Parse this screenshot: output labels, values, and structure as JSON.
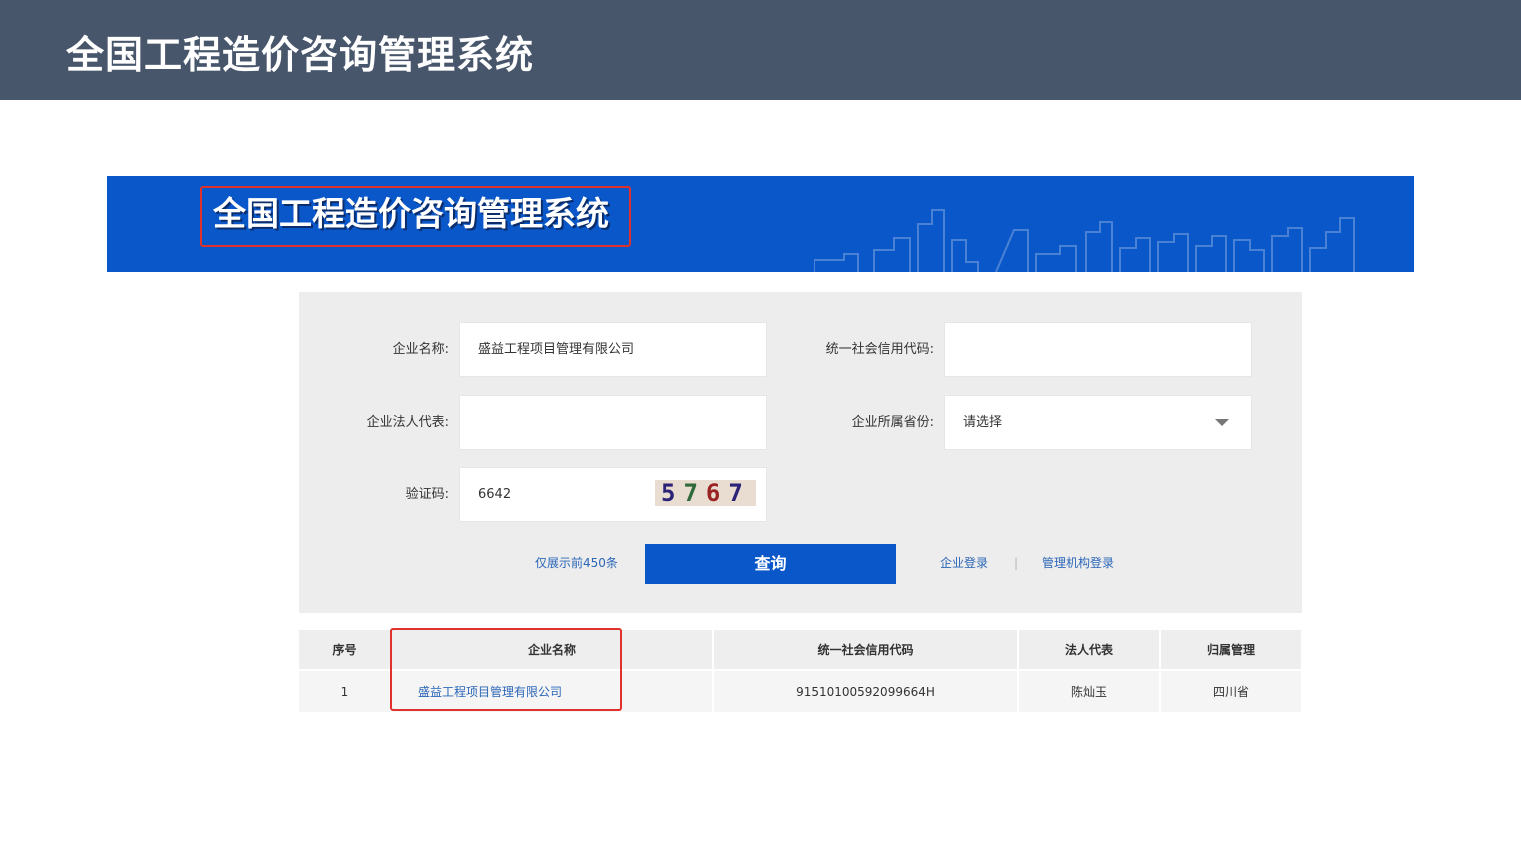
{
  "slide": {
    "title": "全国工程造价咨询管理系统"
  },
  "banner": {
    "title": "全国工程造价咨询管理系统"
  },
  "search_form": {
    "company_name_label": "企业名称:",
    "company_name_value": "盛益工程项目管理有限公司",
    "credit_code_label": "统一社会信用代码:",
    "credit_code_value": "",
    "legal_rep_label": "企业法人代表:",
    "legal_rep_value": "",
    "province_label": "企业所属省份:",
    "province_value": "请选择",
    "captcha_label": "验证码:",
    "captcha_input_value": "6642",
    "captcha_image_digits": [
      "5",
      "7",
      "6",
      "7"
    ],
    "limit_note": "仅展示前450条",
    "query_button": "查询",
    "enterprise_login": "企业登录",
    "separator": "|",
    "admin_login": "管理机构登录"
  },
  "results": {
    "columns": [
      "序号",
      "企业名称",
      "统一社会信用代码",
      "法人代表",
      "归属管理"
    ],
    "rows": [
      {
        "index": "1",
        "company": "盛益工程项目管理有限公司",
        "credit_code": "91510100592099664H",
        "legal_rep": "陈灿玉",
        "region": "四川省"
      }
    ]
  },
  "colors": {
    "slide_header_bg": "#48566c",
    "banner_bg": "#0a57c9",
    "highlight_frame": "#e0312b",
    "link": "#2a66b8",
    "panel_bg": "#ededed"
  }
}
